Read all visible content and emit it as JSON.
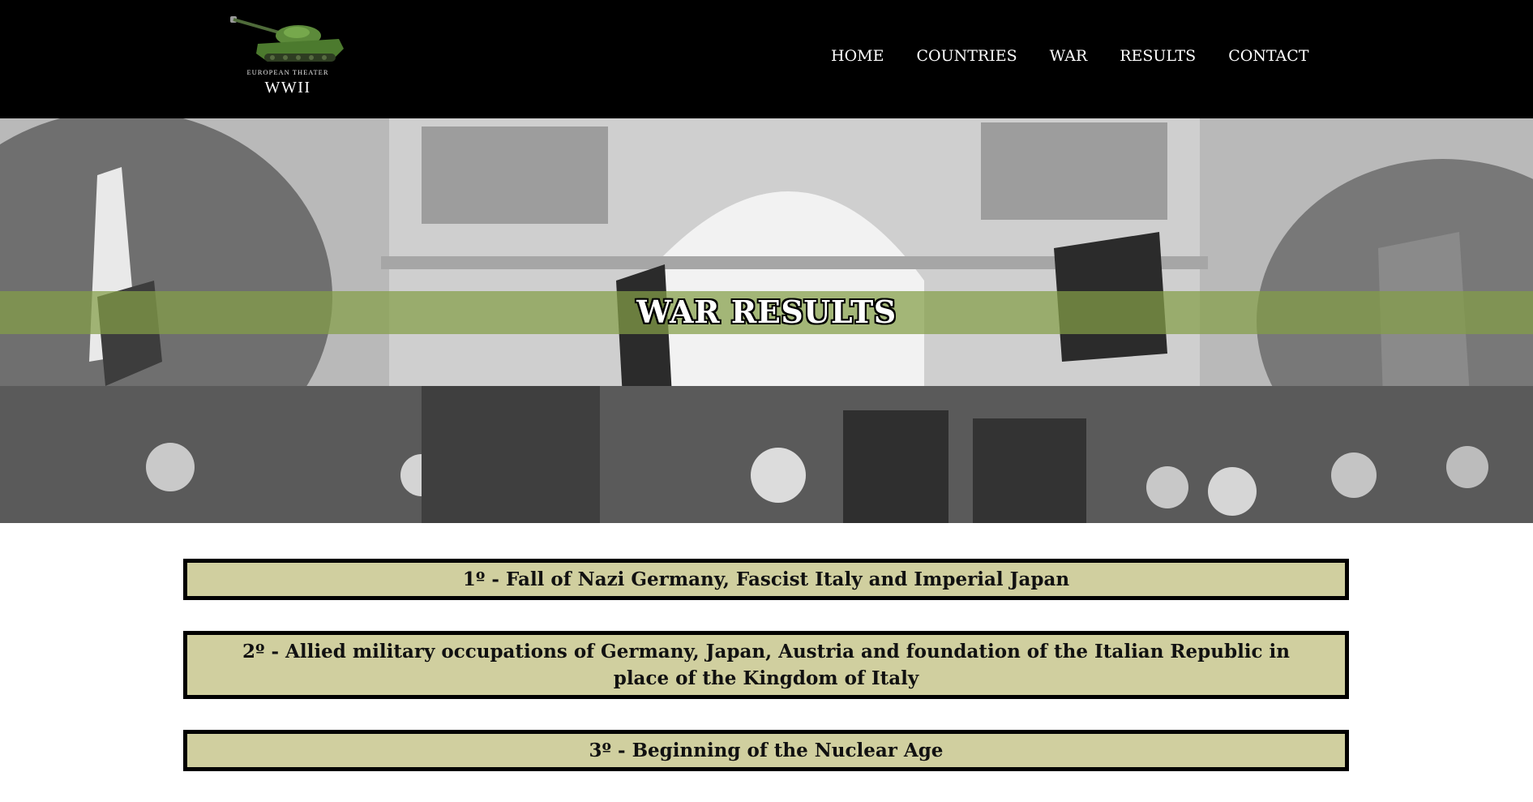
{
  "header": {
    "logo": {
      "subtitle": "EUROPEAN THEATER",
      "title": "WWII"
    },
    "nav": [
      {
        "label": "HOME"
      },
      {
        "label": "COUNTRIES"
      },
      {
        "label": "WAR"
      },
      {
        "label": "RESULTS"
      },
      {
        "label": "CONTACT"
      }
    ]
  },
  "hero": {
    "title": "WAR RESULTS",
    "band_color": "#849e46"
  },
  "results": [
    {
      "text": "1º - Fall of Nazi Germany, Fascist Italy and Imperial Japan"
    },
    {
      "text": "2º - Allied military occupations of Germany, Japan, Austria and foundation of the Italian Republic in place of the Kingdom of Italy"
    },
    {
      "text": "3º - Beginning of the Nuclear Age"
    }
  ],
  "colors": {
    "topbar": "#000000",
    "result_box": "#d0cf9f",
    "result_border": "#000000"
  }
}
